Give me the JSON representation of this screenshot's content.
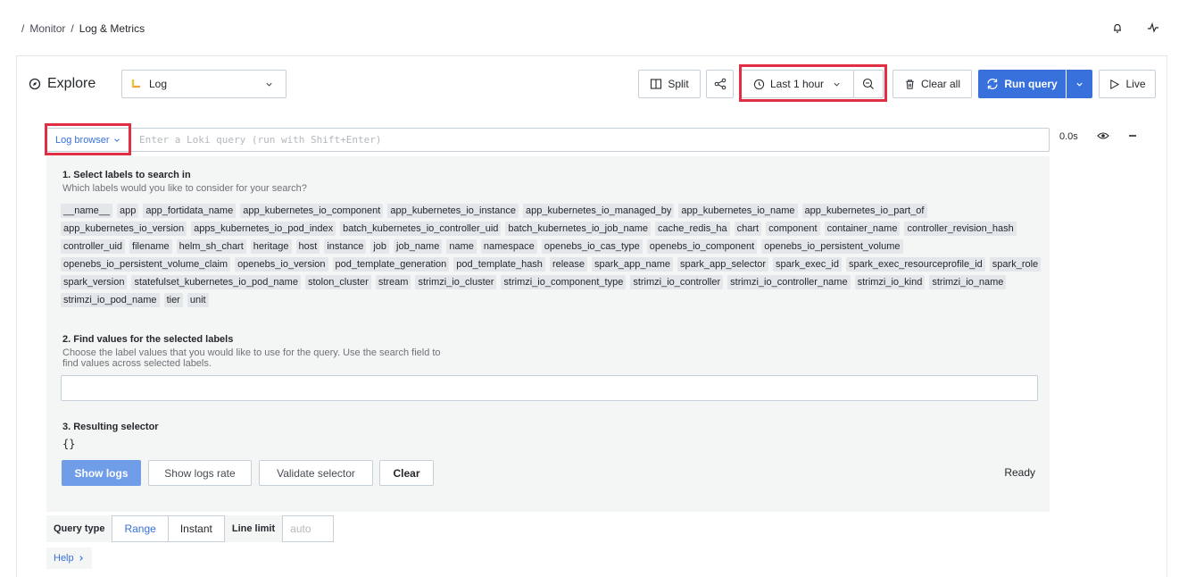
{
  "breadcrumb": {
    "home_icon": "home-icon",
    "items": [
      "Monitor",
      "Log & Metrics"
    ]
  },
  "topbar": {
    "icons": [
      "bell-icon",
      "activity-icon"
    ]
  },
  "explore": {
    "title": "Explore",
    "datasource": "Log",
    "split_label": "Split",
    "time_range": "Last 1 hour",
    "clear_all_label": "Clear all",
    "run_query_label": "Run query",
    "live_label": "Live"
  },
  "query": {
    "log_browser_label": "Log browser",
    "placeholder": "Enter a Loki query (run with Shift+Enter)",
    "duration": "0.0s"
  },
  "browser": {
    "step1_title": "1. Select labels to search in",
    "step1_sub": "Which labels would you like to consider for your search?",
    "labels": [
      "__name__",
      "app",
      "app_fortidata_name",
      "app_kubernetes_io_component",
      "app_kubernetes_io_instance",
      "app_kubernetes_io_managed_by",
      "app_kubernetes_io_name",
      "app_kubernetes_io_part_of",
      "app_kubernetes_io_version",
      "apps_kubernetes_io_pod_index",
      "batch_kubernetes_io_controller_uid",
      "batch_kubernetes_io_job_name",
      "cache_redis_ha",
      "chart",
      "component",
      "container_name",
      "controller_revision_hash",
      "controller_uid",
      "filename",
      "helm_sh_chart",
      "heritage",
      "host",
      "instance",
      "job",
      "job_name",
      "name",
      "namespace",
      "openebs_io_cas_type",
      "openebs_io_component",
      "openebs_io_persistent_volume",
      "openebs_io_persistent_volume_claim",
      "openebs_io_version",
      "pod_template_generation",
      "pod_template_hash",
      "release",
      "spark_app_name",
      "spark_app_selector",
      "spark_exec_id",
      "spark_exec_resourceprofile_id",
      "spark_role",
      "spark_version",
      "statefulset_kubernetes_io_pod_name",
      "stolon_cluster",
      "stream",
      "strimzi_io_cluster",
      "strimzi_io_component_type",
      "strimzi_io_controller",
      "strimzi_io_controller_name",
      "strimzi_io_kind",
      "strimzi_io_name",
      "strimzi_io_pod_name",
      "tier",
      "unit"
    ],
    "step2_title": "2. Find values for the selected labels",
    "step2_sub_line1": "Choose the label values that you would like to use for the query. Use the search field to",
    "step2_sub_line2": "find values across selected labels.",
    "step3_title": "3. Resulting selector",
    "selector": "{}",
    "show_logs": "Show logs",
    "show_logs_rate": "Show logs rate",
    "validate_selector": "Validate selector",
    "clear": "Clear",
    "status": "Ready"
  },
  "options": {
    "query_type_label": "Query type",
    "range": "Range",
    "instant": "Instant",
    "line_limit_label": "Line limit",
    "line_limit_placeholder": "auto",
    "help_label": "Help"
  },
  "colors": {
    "accent": "#3871dc",
    "highlight": "#e02f44",
    "panel": "#f4f5f5"
  }
}
